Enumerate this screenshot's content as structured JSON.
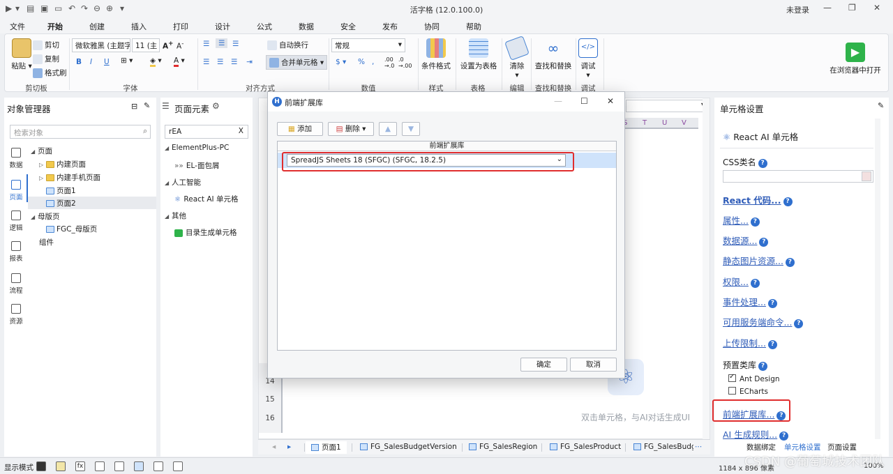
{
  "app": {
    "title": "活字格 (12.0.100.0)",
    "login_status": "未登录"
  },
  "menu": {
    "tabs": [
      "文件",
      "开始",
      "创建",
      "插入",
      "打印",
      "设计",
      "公式",
      "数据",
      "安全",
      "发布",
      "协同",
      "帮助"
    ],
    "active": "开始"
  },
  "ribbon": {
    "clipboard": {
      "paste": "粘贴",
      "cut": "剪切",
      "copy": "复制",
      "format_painter": "格式刷",
      "group": "剪切板"
    },
    "font": {
      "family": "微软雅黑 (主题字",
      "size": "11 (主",
      "bold": "B",
      "italic": "I",
      "underline": "U",
      "group": "字体"
    },
    "alignment": {
      "wrap": "自动换行",
      "merge": "合并单元格",
      "group": "对齐方式"
    },
    "number": {
      "format": "常规",
      "currency": "$",
      "percent": "%",
      "comma": ",",
      "group": "数值"
    },
    "style": {
      "conditional": "条件格式",
      "group": "样式"
    },
    "table": {
      "set_table": "设置为表格",
      "group": "表格"
    },
    "edit": {
      "clear": "清除",
      "group": "编辑"
    },
    "find": {
      "find_replace": "查找和替换",
      "group": "查找和替换"
    },
    "debug": {
      "debug": "调试",
      "group": "调试"
    },
    "browser": {
      "open": "在浏览器中打开"
    }
  },
  "object_manager": {
    "title": "对象管理器",
    "search_placeholder": "检索对象",
    "side_buttons": [
      "数据",
      "页面",
      "逻辑",
      "报表",
      "流程",
      "资源"
    ],
    "tree": {
      "pages": "页面",
      "new_page": "内建页面",
      "new_mobile_page": "内建手机页面",
      "page1": "页面1",
      "page2": "页面2",
      "master": "母版页",
      "master_page": "FGC_母版页",
      "components": "组件"
    }
  },
  "page_elements": {
    "title": "页面元素",
    "search_value": "rEA",
    "clear": "X",
    "groups": [
      {
        "name": "ElementPlus-PC",
        "items": [
          "EL-面包屑"
        ]
      },
      {
        "name": "人工智能",
        "items": [
          "React AI 单元格"
        ]
      },
      {
        "name": "其他",
        "items": [
          "目录生成单元格"
        ]
      }
    ]
  },
  "canvas": {
    "columns": [
      "S",
      "T",
      "U",
      "V"
    ],
    "rows": [
      "14",
      "15",
      "16"
    ],
    "hint": "双击单元格，与AI对话生成UI"
  },
  "sheet_tabs": [
    "页面1",
    "FG_SalesBudgetVersion",
    "FG_SalesRegion",
    "FG_SalesProduct",
    "FG_SalesBudg"
  ],
  "cell_settings": {
    "title": "单元格设置",
    "cell_type": "React AI 单元格",
    "css_label": "CSS类名",
    "links": [
      "React 代码...",
      "属性...",
      "数据源...",
      "静态图片资源...",
      "权限...",
      "事件处理...",
      "可用服务端命令...",
      "上传限制..."
    ],
    "preset_label": "预置类库",
    "presets": [
      {
        "label": "Ant Design",
        "checked": true
      },
      {
        "label": "ECharts",
        "checked": false
      }
    ],
    "ext_lib_link": "前端扩展库...",
    "ai_rules_link": "AI 生成规则...",
    "bottom_tabs": [
      "数据绑定",
      "单元格设置",
      "页面设置"
    ],
    "active_tab": "单元格设置"
  },
  "statusbar": {
    "mode": "显示模式",
    "dimensions": "1184 x 896 像素",
    "zoom": "100%"
  },
  "dialog": {
    "title": "前端扩展库",
    "add": "添加",
    "delete": "删除",
    "column_header": "前端扩展库",
    "selected_library": "SpreadJS Sheets 18 (SFGC) (SFGC, 18.2.5)",
    "ok": "确定",
    "cancel": "取消"
  },
  "watermark": "CSDN @葡萄城技术团队",
  "colors": {
    "accent": "#2f6fce",
    "highlight_box": "#e02d2d",
    "selection_row": "#cfe3fb"
  }
}
